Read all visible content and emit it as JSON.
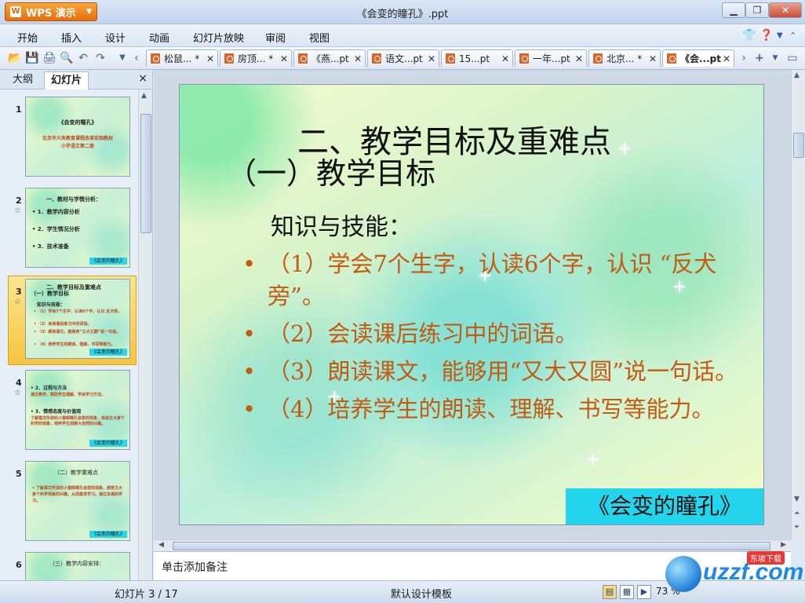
{
  "window": {
    "app_button": "WPS 演示",
    "title": "《会变的瞳孔》.ppt"
  },
  "menu": [
    "开始",
    "插入",
    "设计",
    "动画",
    "幻灯片放映",
    "审阅",
    "视图"
  ],
  "doc_tabs": [
    {
      "label": "松鼠... *"
    },
    {
      "label": "房顶... *"
    },
    {
      "label": "《燕...pt"
    },
    {
      "label": "语文...pt"
    },
    {
      "label": "15...pt"
    },
    {
      "label": "一年...pt"
    },
    {
      "label": "北京... *"
    },
    {
      "label": "《会...pt"
    }
  ],
  "left_pane": {
    "tab_outline": "大纲",
    "tab_slides": "幻灯片",
    "close": "×",
    "thumbnails": [
      {
        "num": "1",
        "lines": [
          "《会变的瞳孔》",
          "北京市义务教育课程改革实验教材",
          "小学语文第二册"
        ]
      },
      {
        "num": "2",
        "lines": [
          "一、教材与学情分析：",
          "• 1．教学内容分析",
          "• 2．学生情况分析",
          "• 3．技术准备"
        ],
        "badge": "《会变的瞳孔》"
      },
      {
        "num": "3",
        "lines": [
          "二、教学目标及重难点",
          "（一）教学目标",
          "知识与技能：",
          "• （1）学会7个生字，认读6个字，认识 反犬旁。",
          "• （2）会读课后练习中的词语。",
          "• （3）朗读课文，能够用“又大又圆”说一句话。",
          "• （4）培养学生的朗读、理解、书写等能力。"
        ],
        "badge": "《会变的瞳孔》"
      },
      {
        "num": "4",
        "lines": [
          "• 2．过程与方法",
          "通过教学，帮助学生理解，学会学习方法。",
          "• 3．情感态度与价值观",
          "了解猫文所讲的小猫眼睛孔会变的现象，体会文大家个科学的现象，培养学生观察大自然的兴趣。"
        ],
        "badge": "《会变的瞳孔》"
      },
      {
        "num": "5",
        "lines": [
          "（二）教学重难点",
          "• 了解课文所讲的小猫眼睛孔会变的现象，感受文大家个科学现象的兴趣，从而激发学习。通过本课的学习。"
        ],
        "badge": "《会变的瞳孔》"
      },
      {
        "num": "6",
        "lines": [
          "（三）教学内容安排："
        ]
      }
    ]
  },
  "slide": {
    "title": "二、教学目标及重难点",
    "subtitle": "（一）教学目标",
    "section": "知识与技能：",
    "bullets": [
      "（1）学会7个生字，认读6个字，认识 “反犬旁”。",
      "（2）会读课后练习中的词语。",
      "（3）朗读课文，能够用“又大又圆”说一句话。",
      "（4）培养学生的朗读、理解、书写等能力。"
    ],
    "badge": "《会变的瞳孔》"
  },
  "notes_placeholder": "单击添加备注",
  "status": {
    "slide_counter": "幻灯片 3 / 17",
    "template": "默认设计模板",
    "zoom": "73 %"
  },
  "watermark": {
    "brand": "uzzf.com",
    "tag": "东坡下载"
  },
  "colors": {
    "bullet_text": "#c55a11",
    "badge_bg": "#22d4ec",
    "wps_orange": "#e56d0c"
  }
}
